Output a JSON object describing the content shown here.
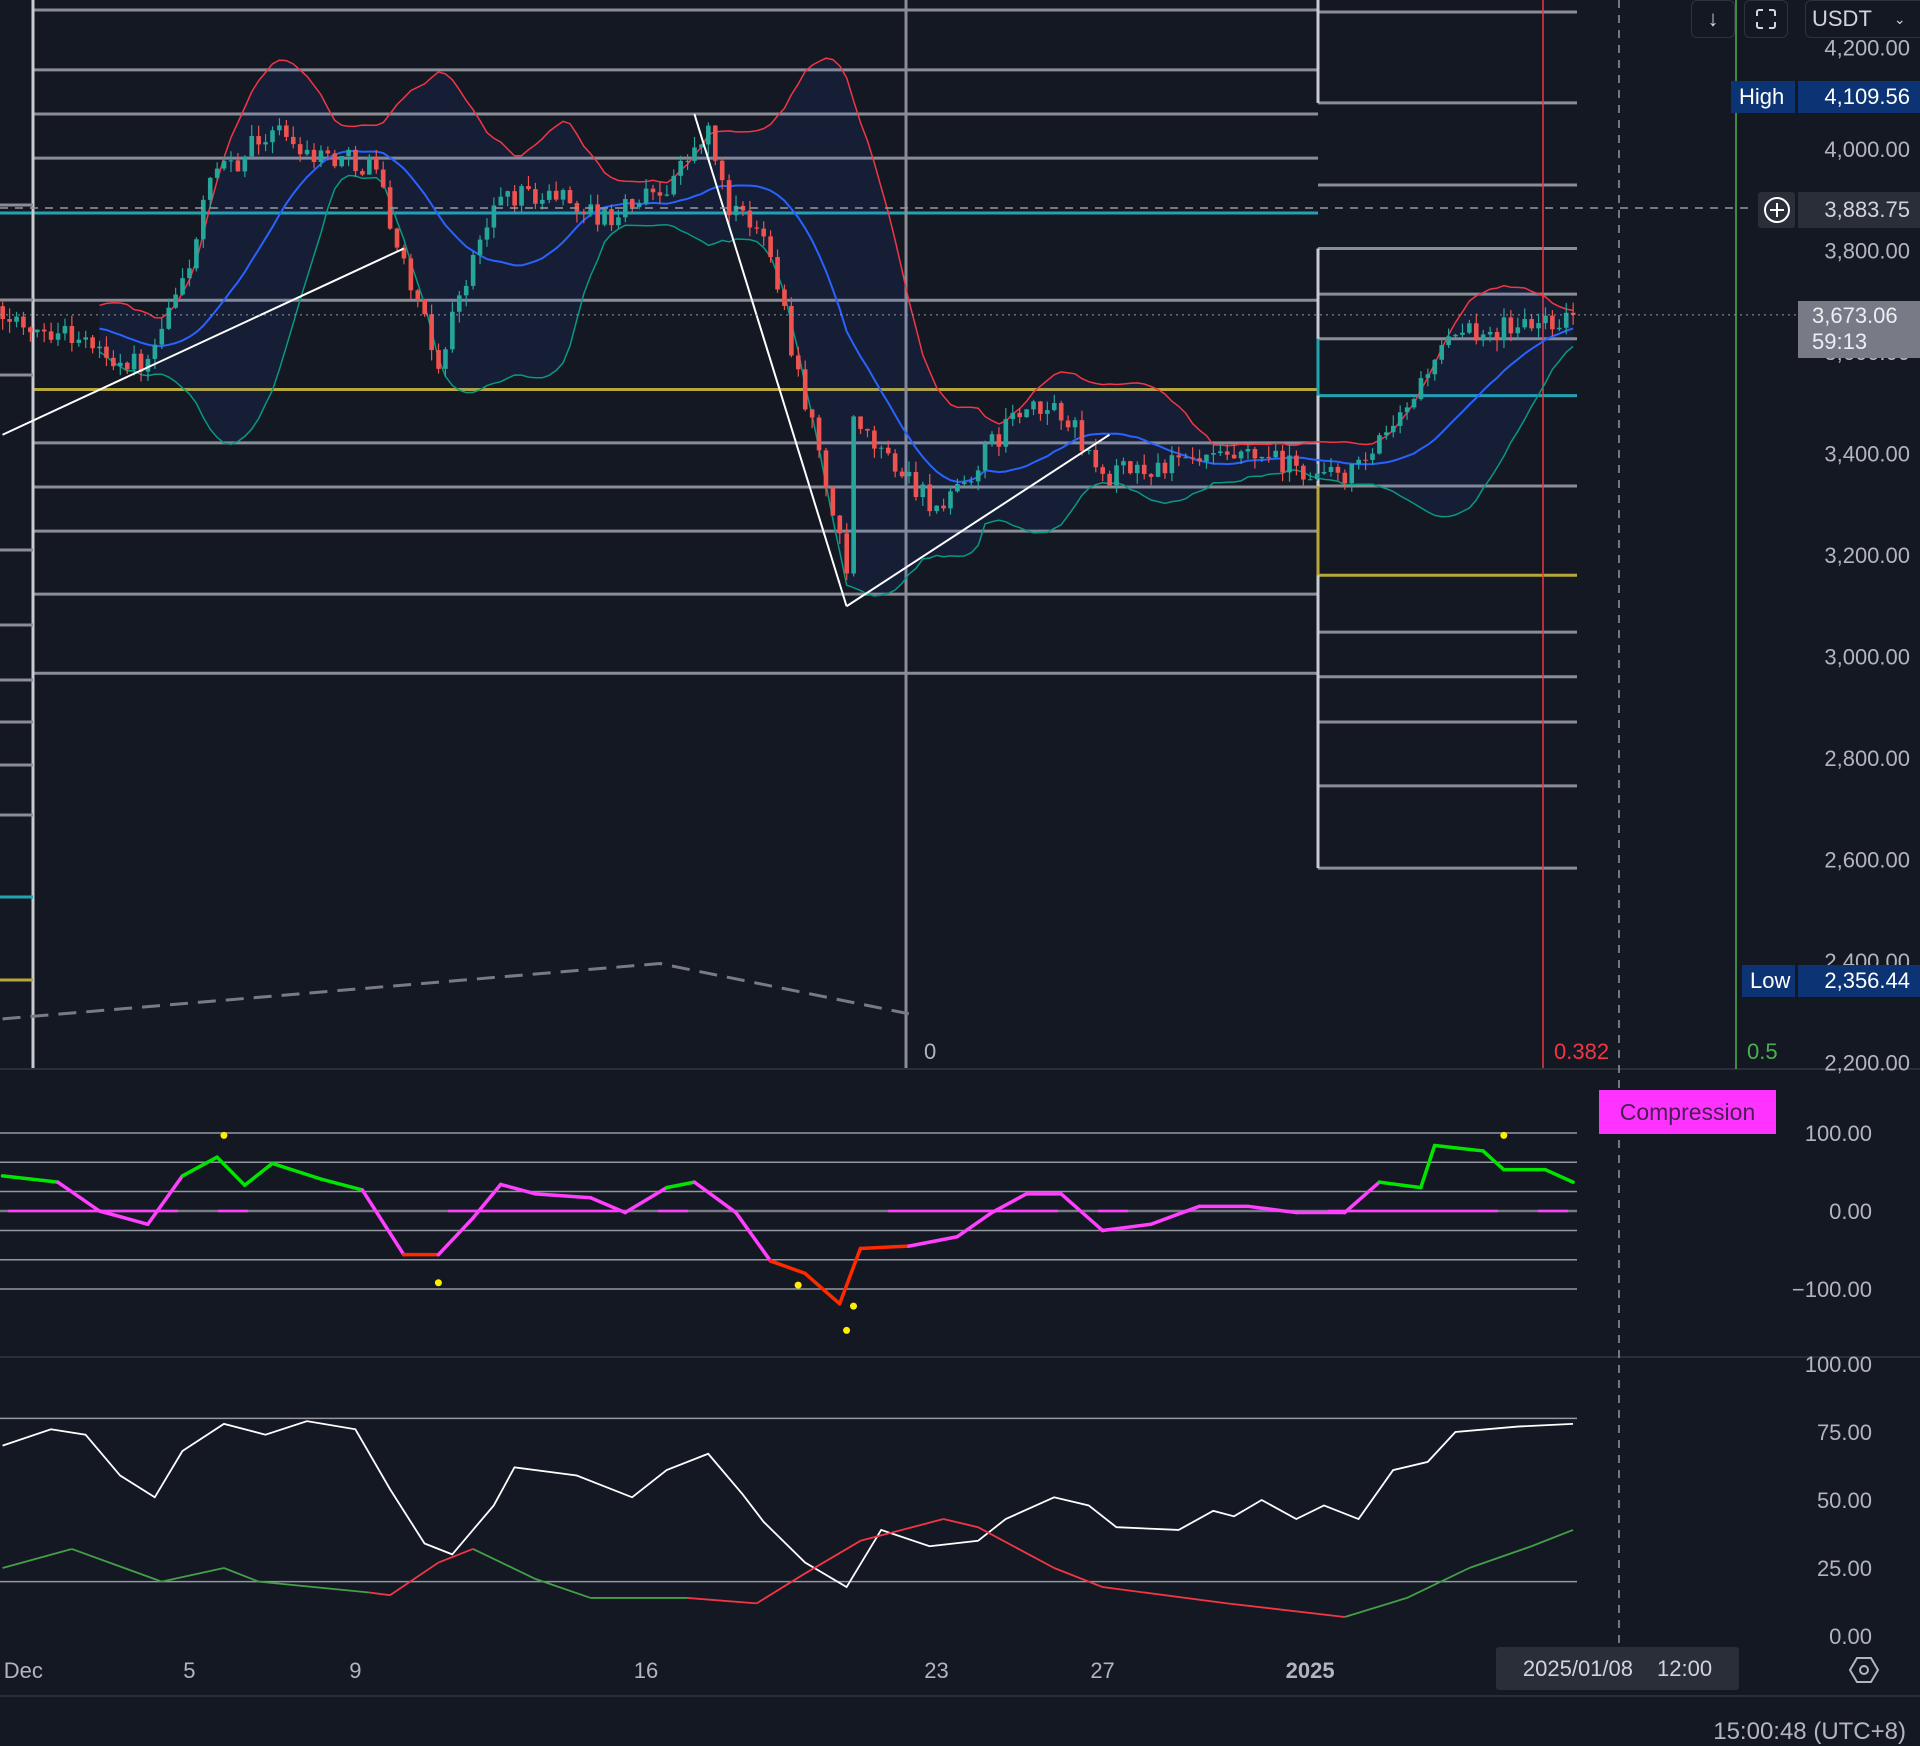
{
  "toolbar": {
    "scroll_icon": "arrow-down-icon",
    "fullscreen_icon": "fullscreen-icon",
    "currency": "USDT",
    "currency_chevron": "chevron-down-icon"
  },
  "price_axis": {
    "ticks": [
      "4,200.00",
      "4,000.00",
      "3,800.00",
      "3,600.00",
      "3,400.00",
      "3,200.00",
      "3,000.00",
      "2,800.00",
      "2,600.00",
      "2,400.00",
      "2,200.00"
    ],
    "high_label": "High",
    "high_value": "4,109.56",
    "crosshair_value": "3,883.75",
    "crosshair_icon": "plus-circle-icon",
    "last_price": "3,673.06",
    "countdown": "59:13",
    "low_label": "Low",
    "low_value": "2,356.44"
  },
  "colors": {
    "background": "#141823",
    "up": "#26a69a",
    "down": "#ef5350",
    "bb_upper": "#f23645",
    "bb_lower": "#089981",
    "bb_basis": "#2962ff",
    "level": "#8a8d96",
    "teal_level": "#22a3b4",
    "yellow_level": "#b8a83c",
    "high_tag": "#0c3474",
    "last_tag": "#787b86",
    "compression": "#ff33ff"
  },
  "main": {
    "price_path": [
      [
        "2024-11-30 12:00",
        3667
      ],
      [
        "2024-12-02 00:00",
        3643
      ],
      [
        "2024-12-03 00:00",
        3594
      ],
      [
        "2024-12-04 00:00",
        3570
      ],
      [
        "2024-12-05 00:00",
        3775
      ],
      [
        "2024-12-05 12:00",
        3932
      ],
      [
        "2024-12-07 00:00",
        4041
      ],
      [
        "2024-12-08 00:00",
        3993
      ],
      [
        "2024-12-09 12:00",
        3969
      ],
      [
        "2024-12-10 00:00",
        3812
      ],
      [
        "2024-12-11 00:00",
        3570
      ],
      [
        "2024-12-11 12:00",
        3715
      ],
      [
        "2024-12-12 12:00",
        3908
      ],
      [
        "2024-12-14 00:00",
        3908
      ],
      [
        "2024-12-15 00:00",
        3860
      ],
      [
        "2024-12-16 12:00",
        3932
      ],
      [
        "2024-12-17 12:00",
        4029
      ],
      [
        "2024-12-18 00:00",
        3884
      ],
      [
        "2024-12-19 00:00",
        3812
      ],
      [
        "2024-12-19 12:00",
        3619
      ],
      [
        "2024-12-20 04:00",
        3401
      ],
      [
        "2024-12-20 20:00",
        3160
      ],
      [
        "2024-12-21 00:00",
        3450
      ],
      [
        "2024-12-22 08:00",
        3353
      ],
      [
        "2024-12-23 04:00",
        3281
      ],
      [
        "2024-12-24 00:00",
        3377
      ],
      [
        "2024-12-24 20:00",
        3474
      ],
      [
        "2024-12-26 00:00",
        3486
      ],
      [
        "2024-12-27 00:00",
        3353
      ],
      [
        "2024-12-28 12:00",
        3377
      ],
      [
        "2024-12-30 20:00",
        3389
      ],
      [
        "2025-01-01 08:00",
        3353
      ],
      [
        "2025-01-02 04:00",
        3365
      ],
      [
        "2025-01-03 04:00",
        3462
      ],
      [
        "2025-01-04 00:00",
        3594
      ],
      [
        "2025-01-05 00:00",
        3643
      ],
      [
        "2025-01-06 08:00",
        3654
      ],
      [
        "2025-01-07 08:00",
        3673
      ]
    ],
    "levels_left": [
      4274,
      4156,
      4069,
      3982,
      3702,
      3421,
      3334,
      3247,
      3123,
      2967
    ],
    "levels_right": [
      4270,
      4091,
      3929,
      3804,
      3714,
      3626,
      3336,
      3048,
      2960,
      2871,
      2745,
      2583
    ],
    "teal_levels": {
      "left": 3874,
      "right": 3514
    },
    "yellow_levels": {
      "left": 3526,
      "right": 3160
    },
    "trendlines": [
      [
        [
          "2024-11-30 12:00",
          3437
        ],
        [
          "2024-12-10 04:00",
          3804
        ]
      ],
      [
        [
          "2024-12-17 04:00",
          4069
        ],
        [
          "2024-12-20 20:00",
          3099
        ]
      ],
      [
        [
          "2024-12-20 20:00",
          3099
        ],
        [
          "2024-12-27 04:00",
          3437
        ]
      ]
    ],
    "dashed_path": [
      [
        "2024-11-30 12:00",
        2286
      ],
      [
        "2024-12-16 08:00",
        2395
      ],
      [
        "2024-12-22 08:00",
        2296
      ]
    ],
    "fib_labels": [
      {
        "text": "0",
        "color": "#b2b5be"
      },
      {
        "text": "0.382",
        "color": "#f23645"
      },
      {
        "text": "0.5",
        "color": "#4caf50"
      }
    ],
    "current_price": 3673.06,
    "crosshair_price": 3883.75
  },
  "oscillator": {
    "ticks": [
      "100.00",
      "0.00",
      "−100.00"
    ],
    "gridlines": [
      100,
      62.5,
      25,
      0,
      -25,
      -62.5,
      -100
    ],
    "label": "Compression",
    "series": [
      [
        "2024-11-30 12:00",
        45
      ],
      [
        "2024-12-01 20:00",
        37
      ],
      [
        "2024-12-02 20:00",
        0
      ],
      [
        "2024-12-04 00:00",
        -17
      ],
      [
        "2024-12-04 20:00",
        45
      ],
      [
        "2024-12-05 16:00",
        69
      ],
      [
        "2024-12-06 08:00",
        33
      ],
      [
        "2024-12-07 00:00",
        61
      ],
      [
        "2024-12-08 04:00",
        41
      ],
      [
        "2024-12-09 04:00",
        27
      ],
      [
        "2024-12-10 04:00",
        -56
      ],
      [
        "2024-12-11 00:00",
        -56
      ],
      [
        "2024-12-11 20:00",
        -9
      ],
      [
        "2024-12-12 12:00",
        34
      ],
      [
        "2024-12-13 08:00",
        22
      ],
      [
        "2024-12-14 16:00",
        17
      ],
      [
        "2024-12-15 12:00",
        -2
      ],
      [
        "2024-12-16 12:00",
        30
      ],
      [
        "2024-12-17 04:00",
        37
      ],
      [
        "2024-12-18 04:00",
        -2
      ],
      [
        "2024-12-19 00:00",
        -64
      ],
      [
        "2024-12-19 20:00",
        -80
      ],
      [
        "2024-12-20 16:00",
        -119
      ],
      [
        "2024-12-21 04:00",
        -48
      ],
      [
        "2024-12-22 08:00",
        -45
      ],
      [
        "2024-12-23 12:00",
        -33
      ],
      [
        "2024-12-24 08:00",
        -2
      ],
      [
        "2024-12-25 04:00",
        22
      ],
      [
        "2024-12-26 00:00",
        22
      ],
      [
        "2024-12-27 00:00",
        -25
      ],
      [
        "2024-12-28 04:00",
        -17
      ],
      [
        "2024-12-29 08:00",
        6
      ],
      [
        "2024-12-30 12:00",
        6
      ],
      [
        "2024-12-31 16:00",
        -2
      ],
      [
        "2025-01-01 20:00",
        -2
      ],
      [
        "2025-01-02 16:00",
        37
      ],
      [
        "2025-01-03 16:00",
        30
      ],
      [
        "2025-01-04 00:00",
        84
      ],
      [
        "2025-01-05 04:00",
        77
      ],
      [
        "2025-01-05 16:00",
        53
      ],
      [
        "2025-01-06 16:00",
        53
      ],
      [
        "2025-01-07 08:00",
        37
      ]
    ],
    "dots": [
      [
        "2024-12-05 20:00",
        97
      ],
      [
        "2024-12-11 00:00",
        -92
      ],
      [
        "2024-12-19 16:00",
        -95
      ],
      [
        "2024-12-20 20:00",
        -153
      ],
      [
        "2024-12-21 00:00",
        -122
      ],
      [
        "2025-01-05 16:00",
        97
      ]
    ],
    "colors": {
      "bull": "#00e600",
      "neutral": "#ff40ff",
      "bear": "#ff2a00",
      "dot": "#ffee00"
    }
  },
  "lower": {
    "ticks": [
      "100.00",
      "75.00",
      "50.00",
      "25.00",
      "0.00"
    ],
    "gridlines": [
      80,
      20
    ],
    "main_series": [
      [
        "2024-11-30 12:00",
        70
      ],
      [
        "2024-12-01 16:00",
        76
      ],
      [
        "2024-12-02 12:00",
        74
      ],
      [
        "2024-12-03 08:00",
        59
      ],
      [
        "2024-12-04 04:00",
        51
      ],
      [
        "2024-12-04 20:00",
        68
      ],
      [
        "2024-12-05 20:00",
        78
      ],
      [
        "2024-12-06 20:00",
        74
      ],
      [
        "2024-12-07 20:00",
        79
      ],
      [
        "2024-12-09 00:00",
        76
      ],
      [
        "2024-12-09 20:00",
        54
      ],
      [
        "2024-12-10 16:00",
        34
      ],
      [
        "2024-12-11 08:00",
        30
      ],
      [
        "2024-12-12 08:00",
        48
      ],
      [
        "2024-12-12 20:00",
        62
      ],
      [
        "2024-12-14 08:00",
        59
      ],
      [
        "2024-12-15 16:00",
        51
      ],
      [
        "2024-12-16 12:00",
        61
      ],
      [
        "2024-12-17 12:00",
        67
      ],
      [
        "2024-12-18 08:00",
        52
      ],
      [
        "2024-12-18 20:00",
        42
      ],
      [
        "2024-12-19 20:00",
        27
      ],
      [
        "2024-12-20 20:00",
        18
      ],
      [
        "2024-12-21 16:00",
        39
      ],
      [
        "2024-12-22 20:00",
        33
      ],
      [
        "2024-12-24 00:00",
        35
      ],
      [
        "2024-12-24 16:00",
        43
      ],
      [
        "2024-12-25 20:00",
        51
      ],
      [
        "2024-12-26 16:00",
        48
      ],
      [
        "2024-12-27 08:00",
        40
      ],
      [
        "2024-12-28 20:00",
        39
      ],
      [
        "2024-12-29 16:00",
        46
      ],
      [
        "2024-12-30 04:00",
        44
      ],
      [
        "2024-12-30 20:00",
        50
      ],
      [
        "2024-12-31 16:00",
        43
      ],
      [
        "2025-01-01 08:00",
        48
      ],
      [
        "2025-01-02 04:00",
        43
      ],
      [
        "2025-01-03 00:00",
        61
      ],
      [
        "2025-01-03 20:00",
        64
      ],
      [
        "2025-01-04 12:00",
        75
      ],
      [
        "2025-01-06 00:00",
        77
      ],
      [
        "2025-01-07 08:00",
        78
      ]
    ],
    "signal_series": [
      [
        "2024-11-30 12:00",
        25,
        "green"
      ],
      [
        "2024-12-02 04:00",
        32,
        "green"
      ],
      [
        "2024-12-04 08:00",
        20,
        "green"
      ],
      [
        "2024-12-05 20:00",
        25,
        "green"
      ],
      [
        "2024-12-06 16:00",
        20,
        "green"
      ],
      [
        "2024-12-09 08:00",
        16,
        "green"
      ],
      [
        "2024-12-09 20:00",
        15,
        "red"
      ],
      [
        "2024-12-11 00:00",
        27,
        "red"
      ],
      [
        "2024-12-11 20:00",
        32,
        "red"
      ],
      [
        "2024-12-13 08:00",
        21,
        "green"
      ],
      [
        "2024-12-14 16:00",
        14,
        "green"
      ],
      [
        "2024-12-17 00:00",
        14,
        "green"
      ],
      [
        "2024-12-18 16:00",
        12,
        "red"
      ],
      [
        "2024-12-19 20:00",
        23,
        "red"
      ],
      [
        "2024-12-21 04:00",
        35,
        "red"
      ],
      [
        "2024-12-23 04:00",
        43,
        "red"
      ],
      [
        "2024-12-24 00:00",
        40,
        "red"
      ],
      [
        "2024-12-25 20:00",
        25,
        "red"
      ],
      [
        "2024-12-27 00:00",
        18,
        "red"
      ],
      [
        "2024-12-30 00:00",
        12,
        "red"
      ],
      [
        "2025-01-01 20:00",
        7,
        "red"
      ],
      [
        "2025-01-03 08:00",
        14,
        "green"
      ],
      [
        "2025-01-04 20:00",
        25,
        "green"
      ],
      [
        "2025-01-06 08:00",
        33,
        "green"
      ],
      [
        "2025-01-07 08:00",
        39,
        "green"
      ]
    ]
  },
  "time_axis": {
    "labels": [
      {
        "text": "Dec",
        "date": "2024-12-01 00:00",
        "bold": false
      },
      {
        "text": "5",
        "date": "2024-12-05 00:00",
        "bold": false
      },
      {
        "text": "9",
        "date": "2024-12-09 00:00",
        "bold": false
      },
      {
        "text": "16",
        "date": "2024-12-16 00:00",
        "bold": false
      },
      {
        "text": "23",
        "date": "2024-12-23 00:00",
        "bold": false
      },
      {
        "text": "27",
        "date": "2024-12-27 00:00",
        "bold": false
      },
      {
        "text": "2025",
        "date": "2025-01-01 00:00",
        "bold": true
      }
    ],
    "crosshair_date": "2025/01/08",
    "crosshair_time": "12:00",
    "settings_icon": "settings-icon"
  },
  "status": {
    "clock": "15:00:48 (UTC+8)"
  }
}
